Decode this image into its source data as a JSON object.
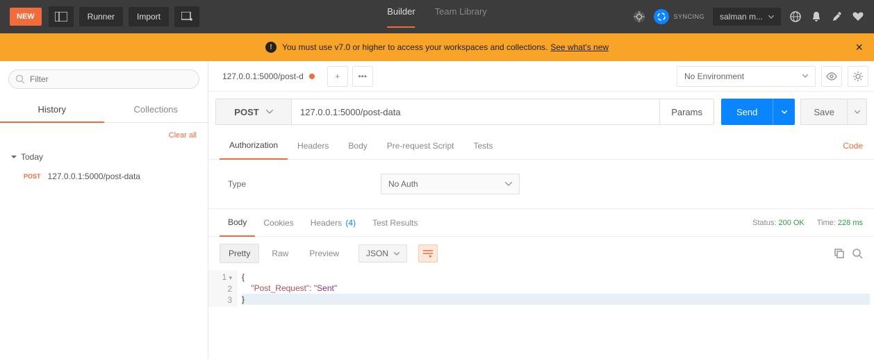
{
  "topbar": {
    "new_label": "NEW",
    "runner_label": "Runner",
    "import_label": "Import",
    "tabs": {
      "builder": "Builder",
      "team": "Team Library"
    },
    "sync_label": "SYNCING",
    "user_label": "salman m..."
  },
  "banner": {
    "text": "You must use v7.0 or higher to access your workspaces and collections.",
    "link": "See what's new"
  },
  "sidebar": {
    "filter_placeholder": "Filter",
    "tabs": {
      "history": "History",
      "collections": "Collections"
    },
    "clear_all": "Clear all",
    "group_label": "Today",
    "items": [
      {
        "method": "POST",
        "url": "127.0.0.1:5000/post-data"
      }
    ]
  },
  "request_tab": {
    "label": "127.0.0.1:5000/post-d"
  },
  "environment": {
    "label": "No Environment"
  },
  "request": {
    "method": "POST",
    "url": "127.0.0.1:5000/post-data",
    "params_label": "Params",
    "send_label": "Send",
    "save_label": "Save"
  },
  "section_tabs": {
    "auth": "Authorization",
    "headers": "Headers",
    "body": "Body",
    "prereq": "Pre-request Script",
    "tests": "Tests",
    "code": "Code"
  },
  "auth": {
    "type_label": "Type",
    "value": "No Auth"
  },
  "response_tabs": {
    "body": "Body",
    "cookies": "Cookies",
    "headers": "Headers",
    "headers_count": "(4)",
    "tests": "Test Results"
  },
  "status": {
    "status_label": "Status:",
    "status_value": "200 OK",
    "time_label": "Time:",
    "time_value": "228 ms"
  },
  "view": {
    "pretty": "Pretty",
    "raw": "Raw",
    "preview": "Preview",
    "format": "JSON"
  },
  "code": {
    "lines": [
      "1",
      "2",
      "3"
    ],
    "l1": "{",
    "l2_indent": "    ",
    "l2_key": "\"Post_Request\"",
    "l2_colon": ": ",
    "l2_val": "\"Sent\"",
    "l3": "}"
  }
}
